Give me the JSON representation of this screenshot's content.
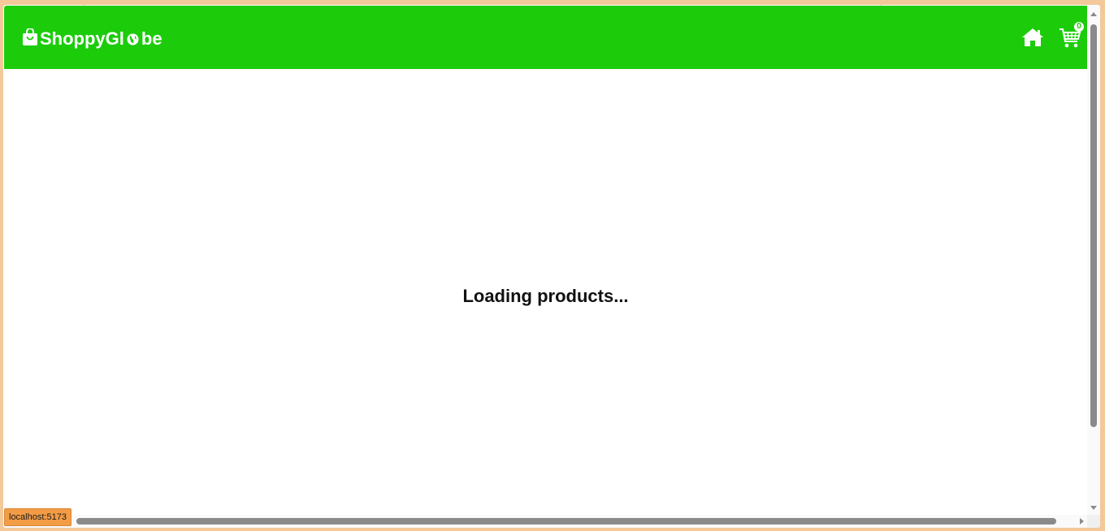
{
  "navbar": {
    "brand_name_part1": "ShoppyGl",
    "brand_name_part2": "be",
    "icons": {
      "logo": "shopping-bag-icon",
      "globe": "globe-icon",
      "home": "home-icon",
      "cart": "shopping-cart-icon"
    },
    "cart_count": "0"
  },
  "main": {
    "loading_text": "Loading products..."
  },
  "status_bar": {
    "link_preview": "localhost:5173"
  },
  "colors": {
    "navbar_bg": "#1ccc0b",
    "page_bg": "#ffffff",
    "frame_bg": "#f3c89a",
    "status_bg": "#f39c45"
  }
}
